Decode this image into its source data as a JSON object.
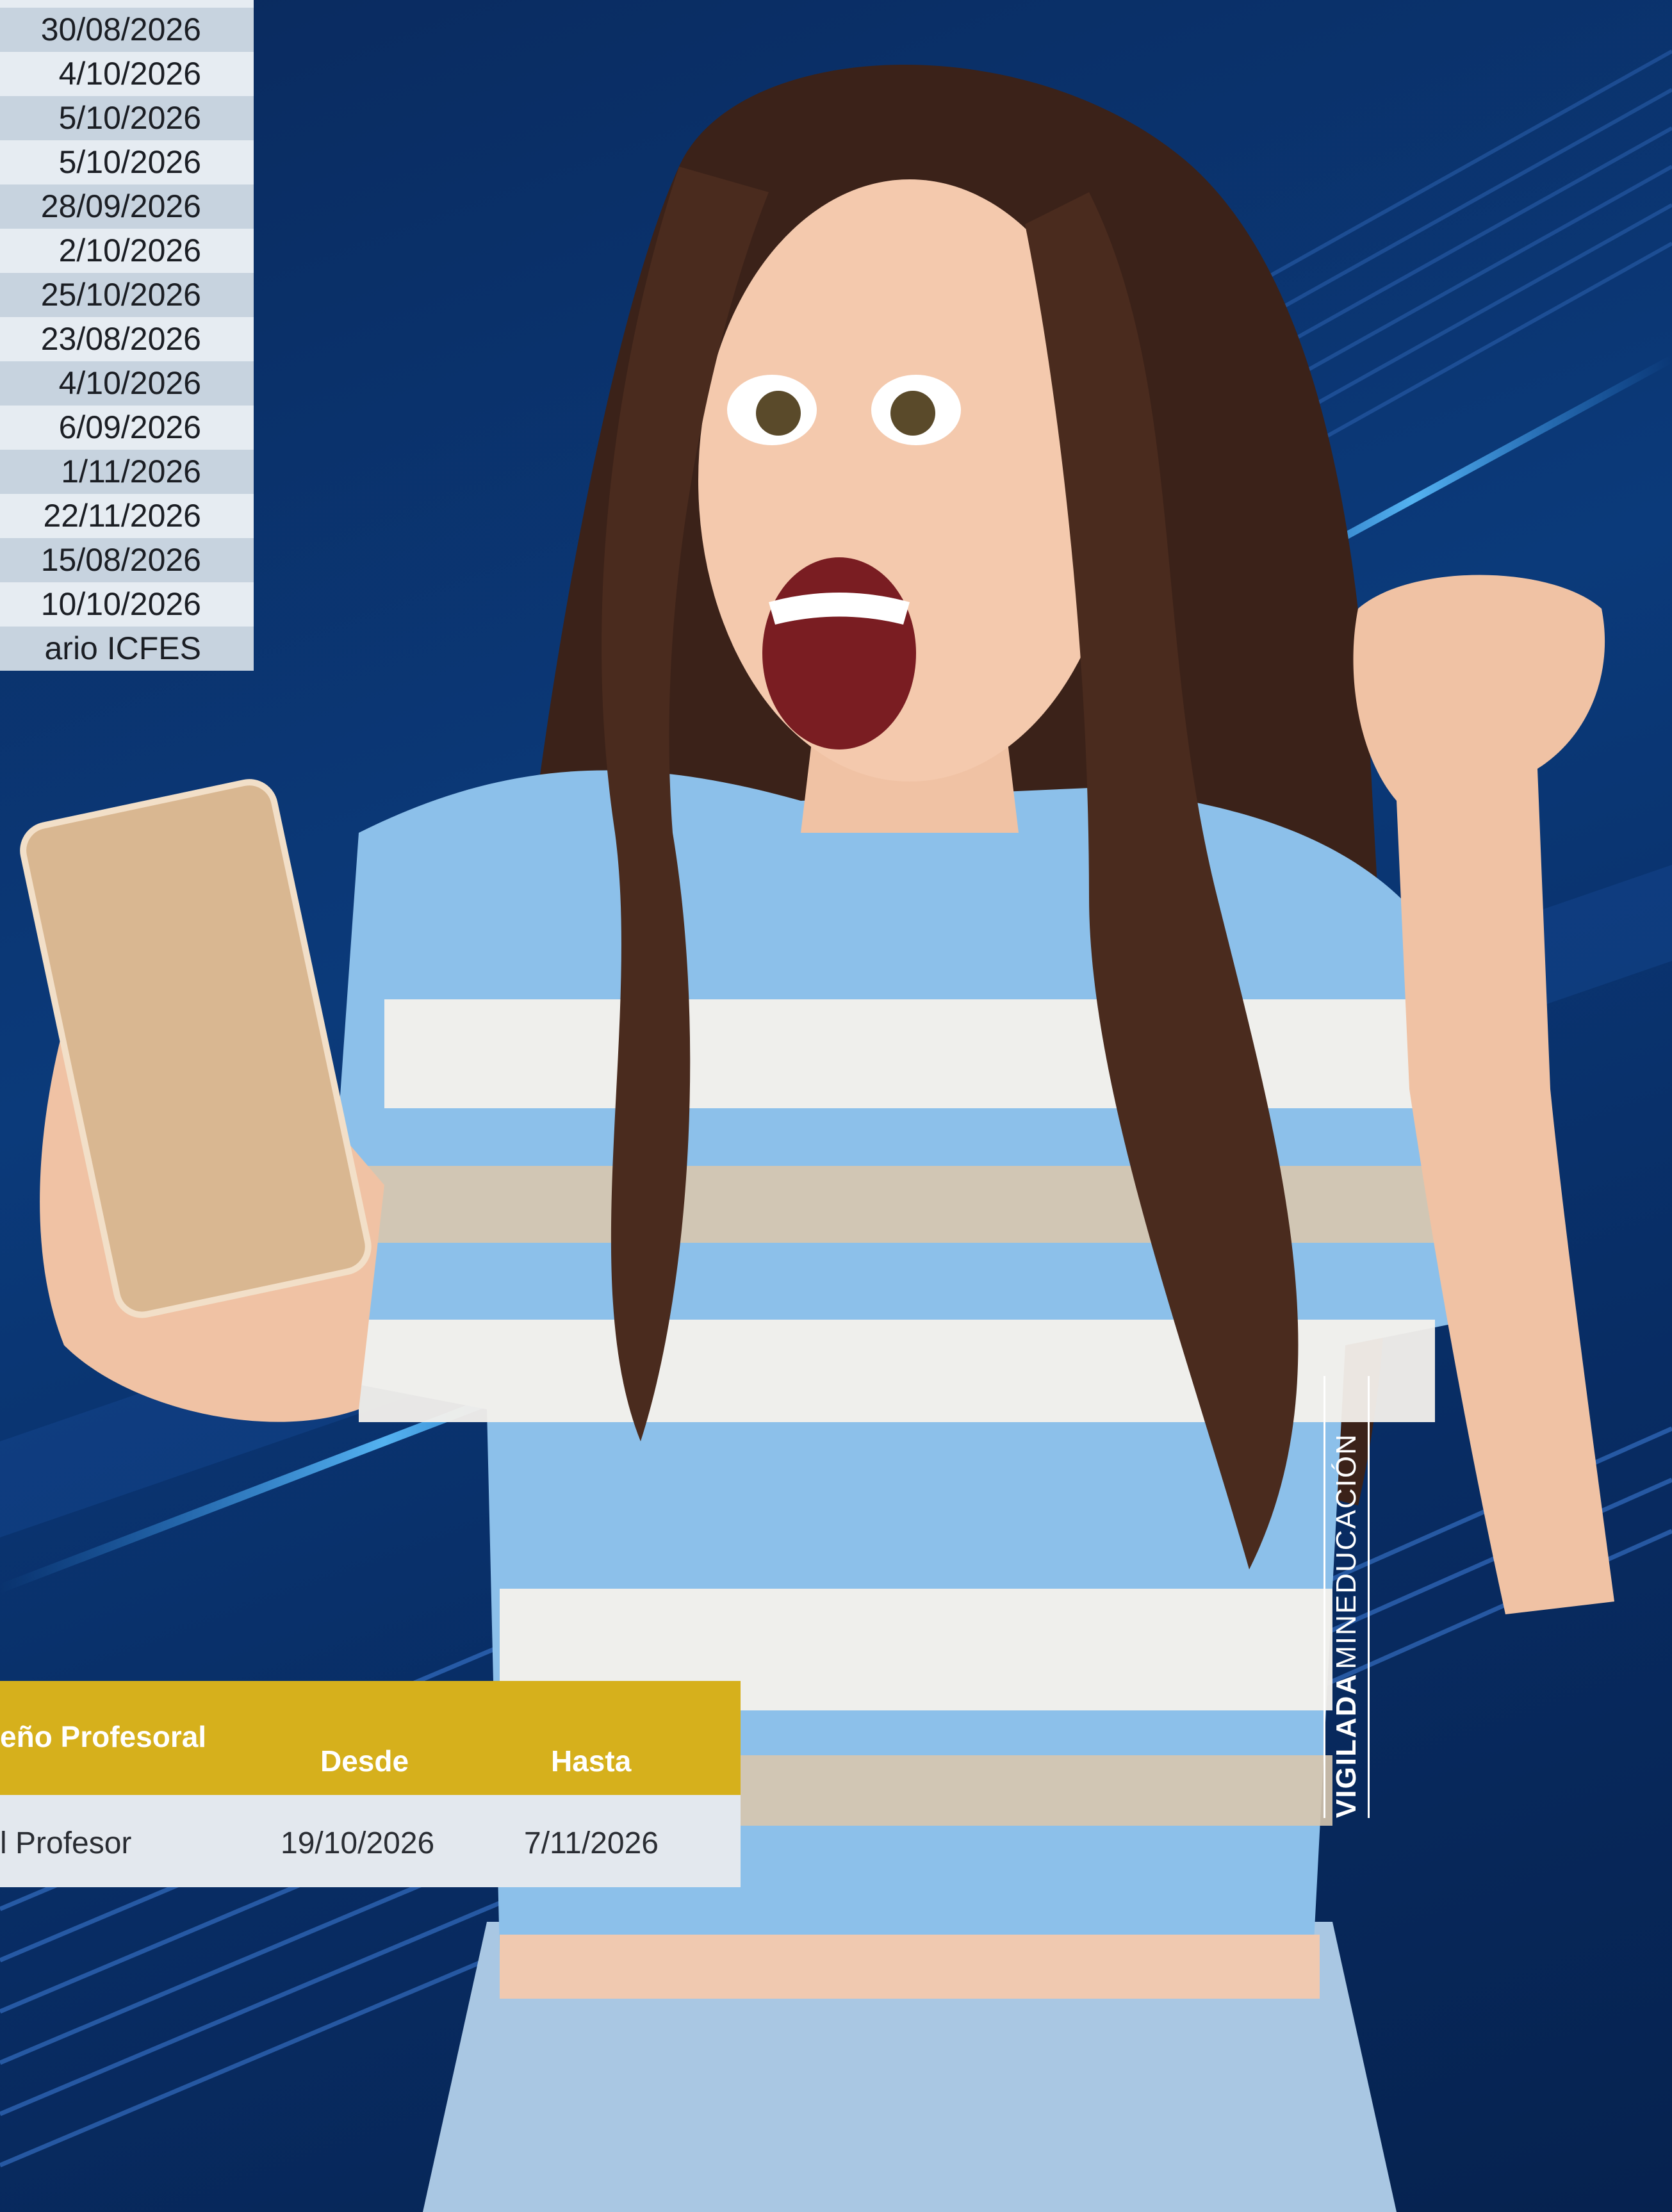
{
  "dates": [
    "",
    "30/08/2026",
    "4/10/2026",
    "5/10/2026",
    "5/10/2026",
    "28/09/2026",
    "2/10/2026",
    "25/10/2026",
    "23/08/2026",
    "4/10/2026",
    "6/09/2026",
    "1/11/2026",
    "22/11/2026",
    "15/08/2026",
    "10/10/2026",
    "ario ICFES"
  ],
  "prof_table": {
    "header_col1": "eño Profesoral",
    "header_desde": "Desde",
    "header_hasta": "Hasta",
    "row_col1": "l Profesor",
    "row_desde": "19/10/2026",
    "row_hasta": "7/11/2026"
  },
  "watermark": {
    "strong": "VIGILADA",
    "rest": "MINEDUCACIÓN"
  },
  "colors": {
    "background": "#0b3a7a",
    "header_yellow": "#d6b01c",
    "table_light": "#e6ecf2",
    "table_dark": "#c7d3df"
  },
  "photo": {
    "subject": "excited-woman-with-phone"
  }
}
